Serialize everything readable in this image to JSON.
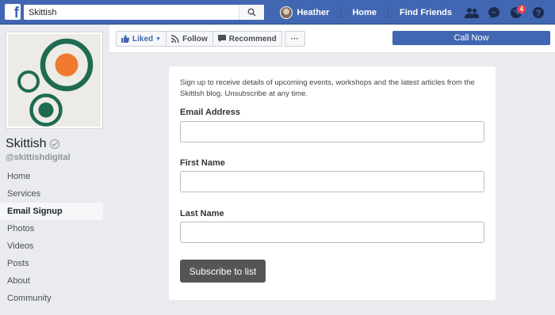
{
  "topbar": {
    "search_value": "Skittish",
    "user_name": "Heather",
    "home_label": "Home",
    "find_friends_label": "Find Friends",
    "notifications_count": "4",
    "brand_color": "#4267b2"
  },
  "actionbar": {
    "liked_label": "Liked",
    "follow_label": "Follow",
    "recommend_label": "Recommend",
    "more_label": "···",
    "call_now_label": "Call Now"
  },
  "sidebar": {
    "page_name": "Skittish",
    "handle": "@skittishdigital",
    "items": [
      {
        "label": "Home"
      },
      {
        "label": "Services"
      },
      {
        "label": "Email Signup"
      },
      {
        "label": "Photos"
      },
      {
        "label": "Videos"
      },
      {
        "label": "Posts"
      },
      {
        "label": "About"
      },
      {
        "label": "Community"
      }
    ],
    "active_item": "Email Signup"
  },
  "form": {
    "intro": "Sign up to receive details of upcoming events, workshops and the latest articles from the Skittish blog. Unsubscribe at any time.",
    "email_label": "Email Address",
    "email_value": "",
    "first_name_label": "First Name",
    "first_name_value": "",
    "last_name_label": "Last Name",
    "last_name_value": "",
    "submit_label": "Subscribe to list"
  },
  "logo_colors": {
    "ring": "#1e6b52",
    "accent": "#f07a2e",
    "background": "#ecebe5"
  }
}
